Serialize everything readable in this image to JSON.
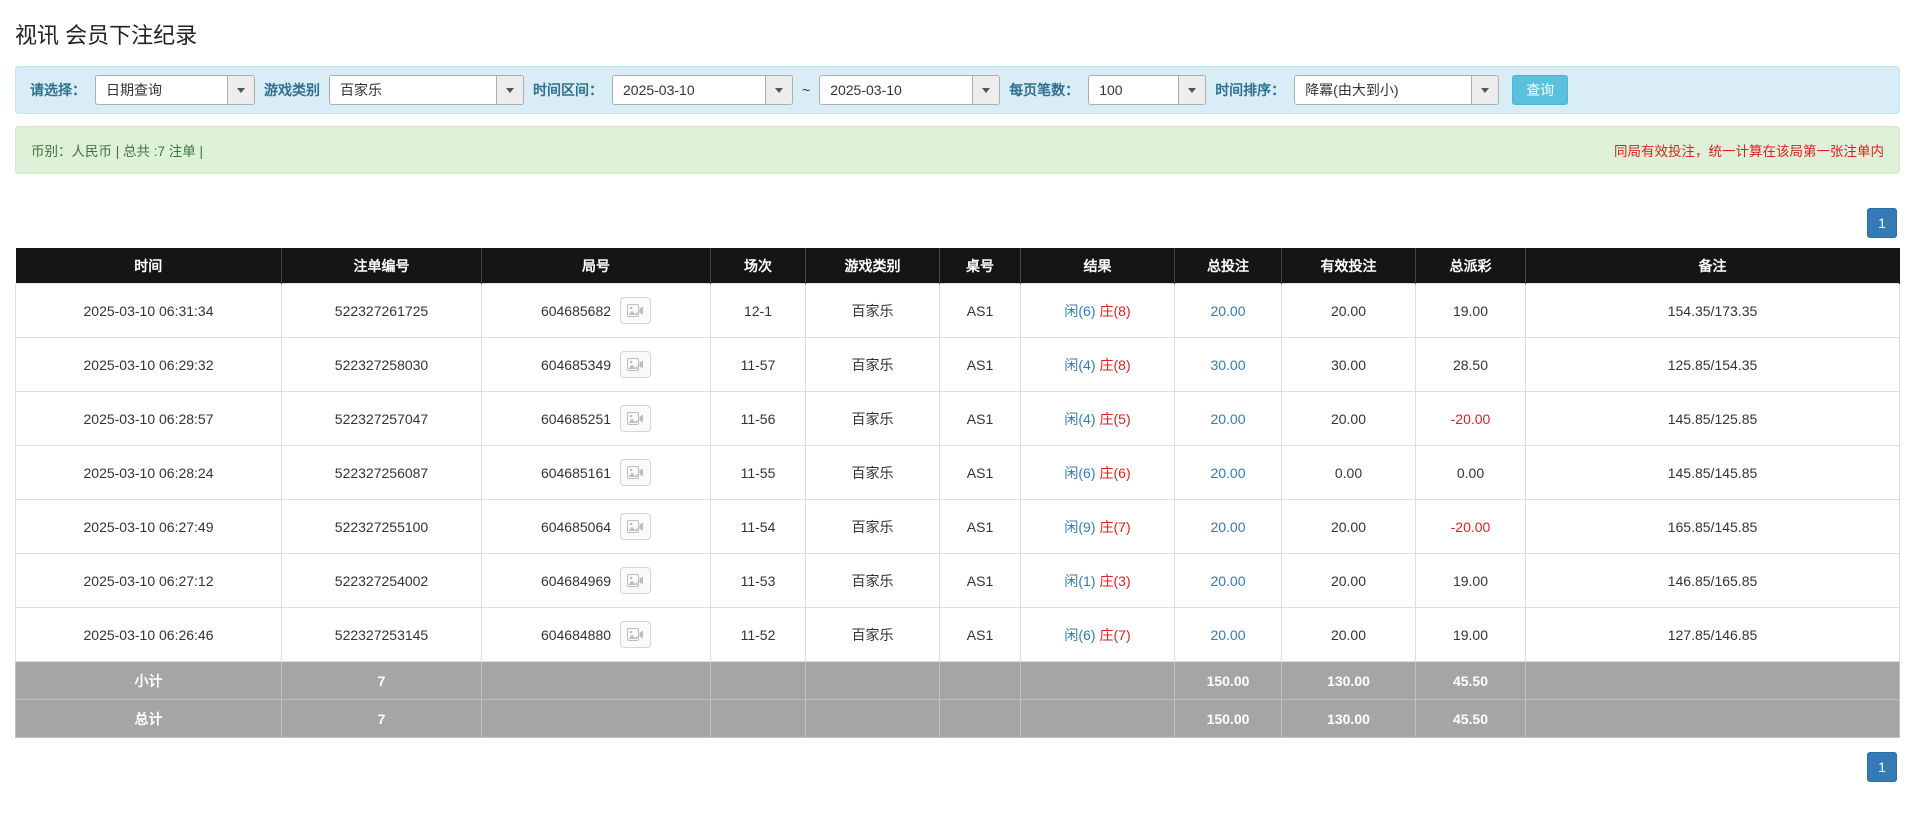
{
  "page": {
    "title": "视讯 会员下注纪录"
  },
  "filters": {
    "select_label": "请选择：",
    "select_value": "日期查询",
    "game_type_label": "游戏类别",
    "game_type_value": "百家乐",
    "date_range_label": "时间区间：",
    "date_from": "2025-03-10",
    "date_separator": "~",
    "date_to": "2025-03-10",
    "page_size_label": "每页笔数：",
    "page_size_value": "100",
    "sort_label": "时间排序：",
    "sort_value": "降冪(由大到小)",
    "search_button": "查询"
  },
  "summary": {
    "left": "币别：人民币 | 总共 :7 注单 |",
    "right": "同局有效投注，统一计算在该局第一张注单内"
  },
  "pagination": {
    "page": "1"
  },
  "table": {
    "headers": [
      "时间",
      "注单编号",
      "局号",
      "场次",
      "游戏类别",
      "桌号",
      "结果",
      "总投注",
      "有效投注",
      "总派彩",
      "备注"
    ],
    "rows": [
      {
        "time": "2025-03-10 06:31:34",
        "bet_id": "522327261725",
        "round_id": "604685682",
        "session": "12-1",
        "game": "百家乐",
        "table_no": "AS1",
        "result_player": "闲(6)",
        "result_banker": "庄(8)",
        "total_bet": "20.00",
        "valid_bet": "20.00",
        "payout": "19.00",
        "payout_negative": false,
        "note": "154.35/173.35"
      },
      {
        "time": "2025-03-10 06:29:32",
        "bet_id": "522327258030",
        "round_id": "604685349",
        "session": "11-57",
        "game": "百家乐",
        "table_no": "AS1",
        "result_player": "闲(4)",
        "result_banker": "庄(8)",
        "total_bet": "30.00",
        "valid_bet": "30.00",
        "payout": "28.50",
        "payout_negative": false,
        "note": "125.85/154.35"
      },
      {
        "time": "2025-03-10 06:28:57",
        "bet_id": "522327257047",
        "round_id": "604685251",
        "session": "11-56",
        "game": "百家乐",
        "table_no": "AS1",
        "result_player": "闲(4)",
        "result_banker": "庄(5)",
        "total_bet": "20.00",
        "valid_bet": "20.00",
        "payout": "-20.00",
        "payout_negative": true,
        "note": "145.85/125.85"
      },
      {
        "time": "2025-03-10 06:28:24",
        "bet_id": "522327256087",
        "round_id": "604685161",
        "session": "11-55",
        "game": "百家乐",
        "table_no": "AS1",
        "result_player": "闲(6)",
        "result_banker": "庄(6)",
        "total_bet": "20.00",
        "valid_bet": "0.00",
        "payout": "0.00",
        "payout_negative": false,
        "note": "145.85/145.85"
      },
      {
        "time": "2025-03-10 06:27:49",
        "bet_id": "522327255100",
        "round_id": "604685064",
        "session": "11-54",
        "game": "百家乐",
        "table_no": "AS1",
        "result_player": "闲(9)",
        "result_banker": "庄(7)",
        "total_bet": "20.00",
        "valid_bet": "20.00",
        "payout": "-20.00",
        "payout_negative": true,
        "note": "165.85/145.85"
      },
      {
        "time": "2025-03-10 06:27:12",
        "bet_id": "522327254002",
        "round_id": "604684969",
        "session": "11-53",
        "game": "百家乐",
        "table_no": "AS1",
        "result_player": "闲(1)",
        "result_banker": "庄(3)",
        "total_bet": "20.00",
        "valid_bet": "20.00",
        "payout": "19.00",
        "payout_negative": false,
        "note": "146.85/165.85"
      },
      {
        "time": "2025-03-10 06:26:46",
        "bet_id": "522327253145",
        "round_id": "604684880",
        "session": "11-52",
        "game": "百家乐",
        "table_no": "AS1",
        "result_player": "闲(6)",
        "result_banker": "庄(7)",
        "total_bet": "20.00",
        "valid_bet": "20.00",
        "payout": "19.00",
        "payout_negative": false,
        "note": "127.85/146.85"
      }
    ],
    "subtotal": {
      "label": "小计",
      "count": "7",
      "total_bet": "150.00",
      "valid_bet": "130.00",
      "payout": "45.50"
    },
    "total": {
      "label": "总计",
      "count": "7",
      "total_bet": "150.00",
      "valid_bet": "130.00",
      "payout": "45.50"
    }
  },
  "colors": {
    "accent_blue": "#337ab7",
    "info_button": "#5bc0de",
    "filter_bg": "#d9edf7",
    "filter_border": "#bce8f1",
    "label_blue": "#31708f",
    "summary_bg": "#dff0d8",
    "summary_border": "#d6e9c6",
    "summary_text": "#3c763d",
    "alert_red": "#e02020",
    "header_bg": "#151515",
    "footer_bg": "#a5a5a5",
    "player_blue": "#337ab7",
    "banker_red": "#e02020",
    "neg_red": "#e02020",
    "link_blue": "#337ab7"
  }
}
